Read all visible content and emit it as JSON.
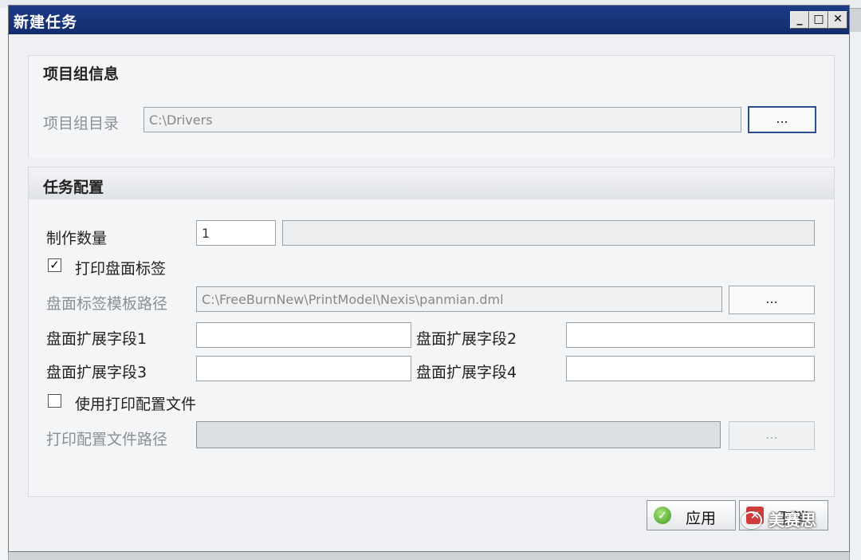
{
  "dialog": {
    "title": "新建任务",
    "window_buttons": {
      "minimize": "_",
      "maximize": "□",
      "close": "✕"
    }
  },
  "project_group": {
    "heading": "项目组信息",
    "dir_label": "项目组目录",
    "dir_value": "C:\\Drivers",
    "browse_label": "..."
  },
  "task_config": {
    "heading": "任务配置",
    "quantity_label": "制作数量",
    "quantity_value": "1",
    "print_label_checkbox": {
      "label": "打印盘面标签",
      "checked": true,
      "mark": "✓"
    },
    "template_path_label": "盘面标签模板路径",
    "template_path_value": "C:\\FreeBurnNew\\PrintModel\\Nexis\\panmian.dml",
    "template_browse_label": "...",
    "ext_fields": [
      {
        "label": "盘面扩展字段1",
        "value": ""
      },
      {
        "label": "盘面扩展字段2",
        "value": ""
      },
      {
        "label": "盘面扩展字段3",
        "value": ""
      },
      {
        "label": "盘面扩展字段4",
        "value": ""
      }
    ],
    "use_print_config_checkbox": {
      "label": "使用打印配置文件",
      "checked": false,
      "mark": ""
    },
    "print_config_path_label": "打印配置文件路径",
    "print_config_path_value": "",
    "print_config_browse_label": "..."
  },
  "footer": {
    "apply_label": "应用",
    "cancel_label": "取消",
    "watermark": "美赛思"
  },
  "colors": {
    "titlebar": "#1d3c86",
    "focus_border": "#2a4f8c",
    "ok_icon": "#3f9b1f",
    "cancel_icon": "#d23b3b"
  }
}
